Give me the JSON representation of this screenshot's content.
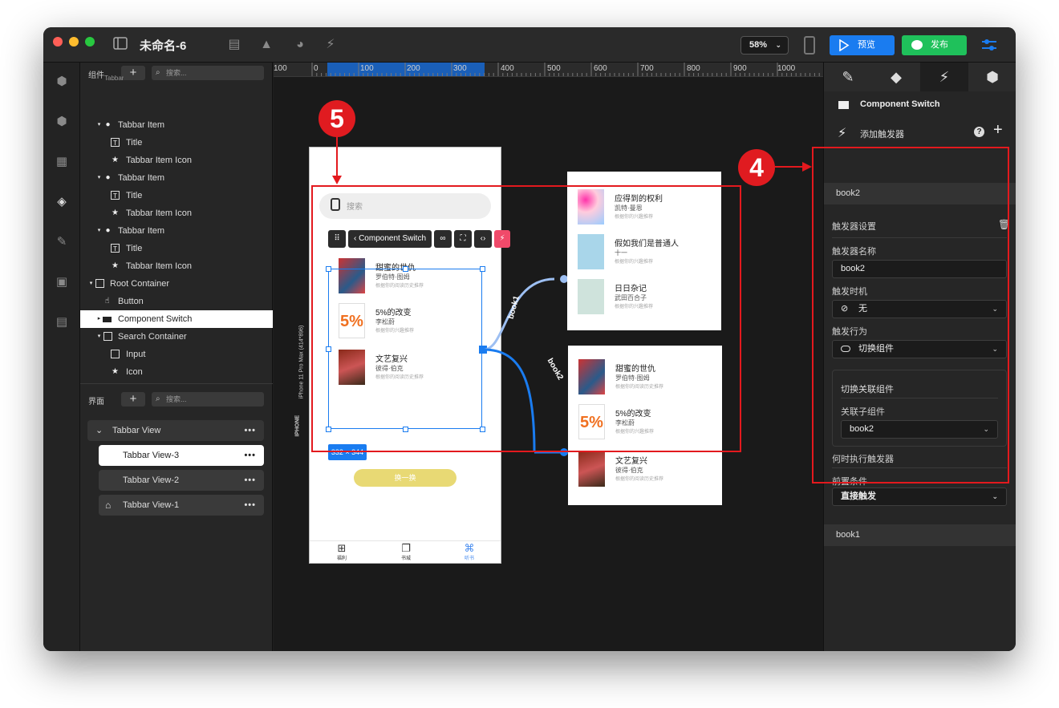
{
  "window": {
    "title": "未命名-6",
    "zoom": "58%",
    "preview_label": "预览",
    "publish_label": "发布"
  },
  "layers_panel": {
    "section_label": "组件",
    "search_placeholder": "搜索...",
    "partial_top": "Tabbar",
    "items": [
      {
        "label": "Tabbar Item",
        "icon": "component-icon"
      },
      {
        "label": "Title",
        "icon": "text-icon"
      },
      {
        "label": "Tabbar Item Icon",
        "icon": "star-icon"
      },
      {
        "label": "Tabbar Item",
        "icon": "component-icon"
      },
      {
        "label": "Title",
        "icon": "text-icon"
      },
      {
        "label": "Tabbar Item Icon",
        "icon": "star-icon"
      },
      {
        "label": "Tabbar Item",
        "icon": "component-icon"
      },
      {
        "label": "Title",
        "icon": "text-icon"
      },
      {
        "label": "Tabbar Item Icon",
        "icon": "star-icon"
      },
      {
        "label": "Root Container",
        "icon": "container-icon"
      },
      {
        "label": "Button",
        "icon": "pointer-icon"
      },
      {
        "label": "Component Switch",
        "icon": "switch-icon"
      },
      {
        "label": "Search Container",
        "icon": "container-icon"
      },
      {
        "label": "Input",
        "icon": "container-icon"
      },
      {
        "label": "Icon",
        "icon": "star-icon"
      }
    ]
  },
  "views_panel": {
    "section_label": "界面",
    "search_placeholder": "搜索...",
    "views": [
      {
        "label": "Tabbar View",
        "more": "•••"
      },
      {
        "label": "Tabbar View-3",
        "more": "•••"
      },
      {
        "label": "Tabbar View-2",
        "more": "•••"
      },
      {
        "label": "Tabbar View-1",
        "more": "•••"
      }
    ]
  },
  "ruler": {
    "labels": [
      "100",
      "0",
      "100",
      "200",
      "300",
      "400",
      "500",
      "600",
      "700",
      "800",
      "900",
      "1000"
    ]
  },
  "canvas": {
    "device_label": "iPhone 11 Pro Max (414*896)",
    "device_type": "IPHONE",
    "search_placeholder": "搜索",
    "toolbar_label": "Component Switch",
    "size_badge": "332 × 344",
    "swap_button": "换一换",
    "tabbar": [
      {
        "label": "福利",
        "icon": "gift-icon"
      },
      {
        "label": "书城",
        "icon": "book-icon"
      },
      {
        "label": "听书",
        "icon": "command-icon"
      }
    ],
    "connector_labels": [
      "book1",
      "book2"
    ],
    "selected_books": [
      {
        "title": "甜蜜的世仇",
        "author": "罗伯特·图姆",
        "note": "根据你的阅读历史推荐"
      },
      {
        "title": "5%的改变",
        "author": "李松蔚",
        "note": "根据你的兴趣推荐"
      },
      {
        "title": "文艺复兴",
        "author": "彼得·伯克",
        "note": "根据你的阅读历史推荐"
      }
    ],
    "book1_card": [
      {
        "title": "应得到的权利",
        "author": "凯特·曼恩",
        "note": "根据你的兴趣推荐"
      },
      {
        "title": "假如我们是普通人",
        "author": "十一",
        "note": "根据你的兴趣推荐"
      },
      {
        "title": "日日杂记",
        "author": "武田百合子",
        "note": "根据你的兴趣推荐"
      }
    ],
    "book2_card": [
      {
        "title": "甜蜜的世仇",
        "author": "罗伯特·图姆",
        "note": "根据你的阅读历史推荐"
      },
      {
        "title": "5%的改变",
        "author": "李松蔚",
        "note": "根据你的兴趣推荐"
      },
      {
        "title": "文艺复兴",
        "author": "彼得·伯克",
        "note": "根据你的阅读历史推荐"
      }
    ]
  },
  "props_panel": {
    "component_name": "Component Switch",
    "add_trigger": "添加触发器",
    "trigger_book2": "book2",
    "trigger_settings": "触发器设置",
    "trigger_name_label": "触发器名称",
    "trigger_name_value": "book2",
    "timing_label": "触发时机",
    "timing_value": "无",
    "action_label": "触发行为",
    "action_value": "切换组件",
    "switch_section": "切换关联组件",
    "child_label": "关联子组件",
    "child_value": "book2",
    "when_label": "何时执行触发器",
    "precondition_label": "前置条件",
    "precondition_value": "直接触发",
    "trigger_book1": "book1"
  },
  "annotations": {
    "badge5": "5",
    "badge4": "4"
  },
  "colors": {
    "accent_blue": "#1a7cf0",
    "publish_green": "#1fc15b",
    "annotation_red": "#e3191e",
    "swap_yellow": "#e8d974",
    "trigger_pink": "#f04a6a"
  }
}
